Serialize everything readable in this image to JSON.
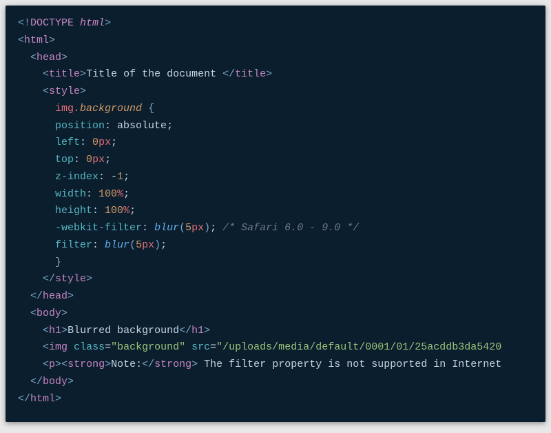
{
  "lines": {
    "l1": {
      "open": "<",
      "bang": "!",
      "doctype": "DOCTYPE ",
      "html": "html",
      "close": ">"
    },
    "l2": {
      "open": "<",
      "tag": "html",
      "close": ">"
    },
    "l3": {
      "indent": "  ",
      "open": "<",
      "tag": "head",
      "close": ">"
    },
    "l4": {
      "indent": "    ",
      "open": "<",
      "tag": "title",
      "close1": ">",
      "text": "Title of the document ",
      "open2": "</",
      "close2": ">"
    },
    "l5": {
      "indent": "    ",
      "open": "<",
      "tag": "style",
      "close": ">"
    },
    "l6": {
      "indent": "      ",
      "sel_el": "img",
      "dot": ".",
      "sel_cl": "background",
      "sp": " ",
      "brace": "{"
    },
    "l7": {
      "indent": "      ",
      "prop": "position",
      "colon": ": ",
      "val": "absolute",
      "semi": ";"
    },
    "l8": {
      "indent": "      ",
      "prop": "left",
      "colon": ": ",
      "num": "0",
      "unit": "px",
      "semi": ";"
    },
    "l9": {
      "indent": "      ",
      "prop": "top",
      "colon": ": ",
      "num": "0",
      "unit": "px",
      "semi": ";"
    },
    "l10": {
      "indent": "      ",
      "prop": "z-index",
      "colon": ": ",
      "val": "-",
      "num": "1",
      "semi": ";"
    },
    "l11": {
      "indent": "      ",
      "prop": "width",
      "colon": ": ",
      "num": "100",
      "unit": "%",
      "semi": ";"
    },
    "l12": {
      "indent": "      ",
      "prop": "height",
      "colon": ": ",
      "num": "100",
      "unit": "%",
      "semi": ";"
    },
    "l13": {
      "indent": "      ",
      "prop": "-webkit-filter",
      "colon": ": ",
      "fn": "blur",
      "paren1": "(",
      "num": "5",
      "unit": "px",
      "paren2": ")",
      "semi": ";",
      "sp": " ",
      "comment": "/* Safari 6.0 - 9.0 */"
    },
    "l14": {
      "indent": "      ",
      "prop": "filter",
      "colon": ": ",
      "fn": "blur",
      "paren1": "(",
      "num": "5",
      "unit": "px",
      "paren2": ")",
      "semi": ";"
    },
    "l15": {
      "indent": "      ",
      "brace": "}"
    },
    "l16": {
      "indent": "    ",
      "open": "</",
      "tag": "style",
      "close": ">"
    },
    "l17": {
      "indent": "  ",
      "open": "</",
      "tag": "head",
      "close": ">"
    },
    "l18": {
      "indent": "  ",
      "open": "<",
      "tag": "body",
      "close": ">"
    },
    "l19": {
      "indent": "    ",
      "open": "<",
      "tag": "h1",
      "close1": ">",
      "text": "Blurred background",
      "open2": "</",
      "close2": ">"
    },
    "l20": {
      "indent": "    ",
      "open": "<",
      "tag": "img",
      "sp": " ",
      "at1": "class",
      "eq1": "=",
      "str1": "\"background\"",
      "sp2": " ",
      "at2": "src",
      "eq2": "=",
      "str2": "\"/uploads/media/default/0001/01/25acddb3da5420"
    },
    "l21": {
      "indent": "    ",
      "open": "<",
      "tag": "p",
      "close1": ">",
      "open2": "<",
      "tag2": "strong",
      "close2": ">",
      "text1": "Note:",
      "open3": "</",
      "close3": ">",
      "text2": " The filter property is not supported in Internet"
    },
    "l22": {
      "indent": "  ",
      "open": "</",
      "tag": "body",
      "close": ">"
    },
    "l23": {
      "open": "</",
      "tag": "html",
      "close": ">"
    }
  }
}
